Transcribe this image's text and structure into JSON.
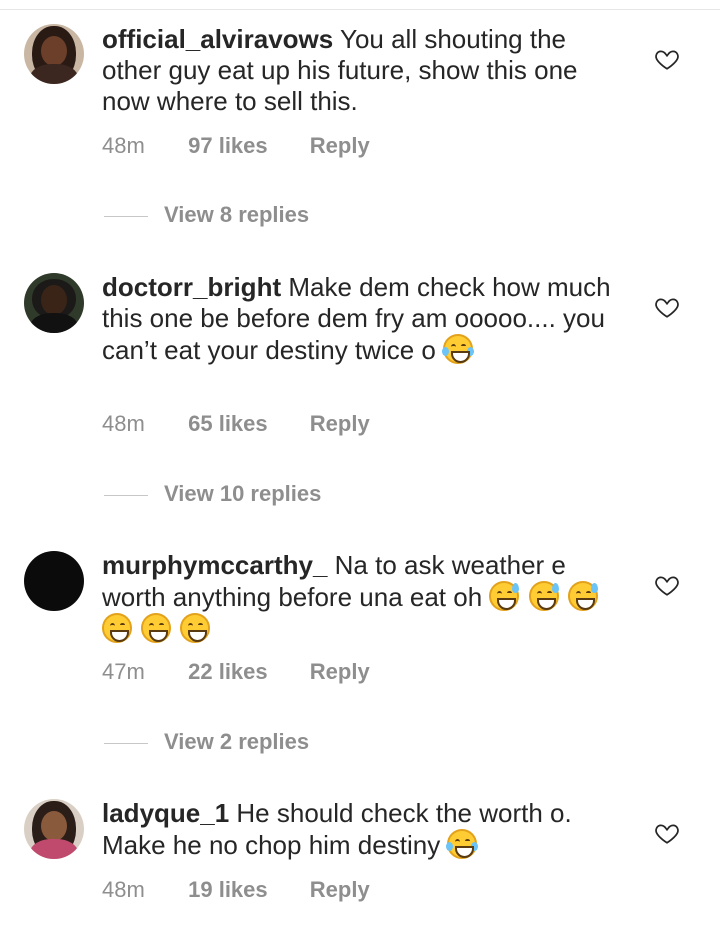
{
  "comments": [
    {
      "username": "official_alviravows",
      "body": "You all shouting the other guy eat up his future, show this one now where to sell this.",
      "time": "48m",
      "likes": "97 likes",
      "reply": "Reply",
      "view_replies": "View 8 replies"
    },
    {
      "username": "doctorr_bright",
      "body": "Make dem check how much this one be before dem fry am ooooo.... you can’t eat your destiny twice o",
      "emojis": [
        "face-with-tears-of-joy"
      ],
      "time": "48m",
      "likes": "65 likes",
      "reply": "Reply",
      "view_replies": "View 10 replies"
    },
    {
      "username": "murphymccarthy_",
      "body": "Na to ask weather e worth anything before una eat oh",
      "emojis": [
        "grinning-face-with-sweat",
        "grinning-face-with-sweat",
        "grinning-face-with-sweat",
        "grinning-squinting-face",
        "grinning-squinting-face",
        "grinning-squinting-face"
      ],
      "time": "47m",
      "likes": "22 likes",
      "reply": "Reply",
      "view_replies": "View 2 replies"
    },
    {
      "username": "ladyque_1",
      "body": "He should check the worth o. Make he no chop him destiny",
      "emojis": [
        "face-with-tears-of-joy"
      ],
      "time": "48m",
      "likes": "19 likes",
      "reply": "Reply"
    }
  ],
  "icons": {
    "like": "heart-outline-icon"
  },
  "colors": {
    "text": "#262626",
    "meta": "#8e8e8e",
    "divider": "#c7c7c7"
  }
}
